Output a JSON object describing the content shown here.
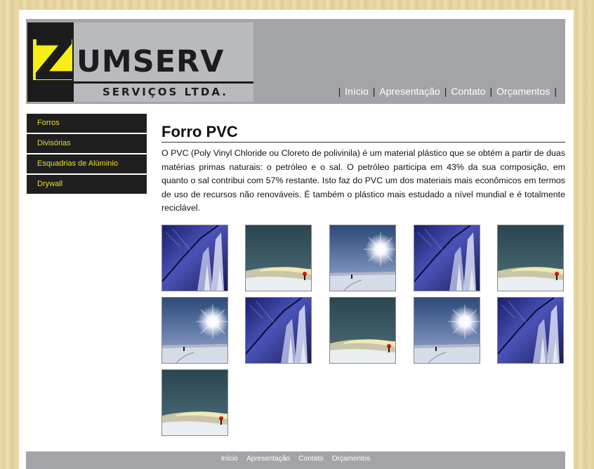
{
  "header": {
    "logo": {
      "letter": "Z",
      "rest": "UMSERV",
      "subtitle": "SERVIÇOS LTDA."
    },
    "nav": [
      {
        "label": "Início"
      },
      {
        "label": "Apresentação"
      },
      {
        "label": "Contato"
      },
      {
        "label": "Orçamentos"
      }
    ],
    "separator": "|"
  },
  "sidebar": {
    "items": [
      {
        "label": "Forros"
      },
      {
        "label": "Divisórias"
      },
      {
        "label": "Esquadrias de Alúminio"
      },
      {
        "label": "Drywall"
      }
    ]
  },
  "main": {
    "title": "Forro PVC",
    "description": "O PVC (Poly Vinyl Chloride ou Cloreto de polivinila) é um material plástico que se obtém a partir de duas matérias primas naturais: o petróleo e o sal. O petróleo participa em 43% da sua composição, em quanto o sal contribui com 57% restante. Isto faz do PVC um dos materiais mais econômicos em termos de uso de recursos não renováveis. É também o plástico mais estudado a nível mundial e é totalmente reciclável."
  },
  "gallery": {
    "thumbnails": [
      "ice-wall",
      "snow-dusk",
      "snow-sun",
      "ice-wall",
      "snow-dusk",
      "snow-sun",
      "ice-wall",
      "snow-dusk",
      "snow-sun",
      "ice-wall",
      "snow-dusk"
    ]
  },
  "footer": {
    "links": [
      {
        "label": "Início"
      },
      {
        "label": "Apresentação"
      },
      {
        "label": "Contato"
      },
      {
        "label": "Orçamentos"
      }
    ]
  },
  "colors": {
    "header_bg": "#a3a4a8",
    "sidebar_bg": "#1f1f1f",
    "sidebar_text": "#f0dc2c",
    "logo_yellow": "#f7ee16"
  }
}
